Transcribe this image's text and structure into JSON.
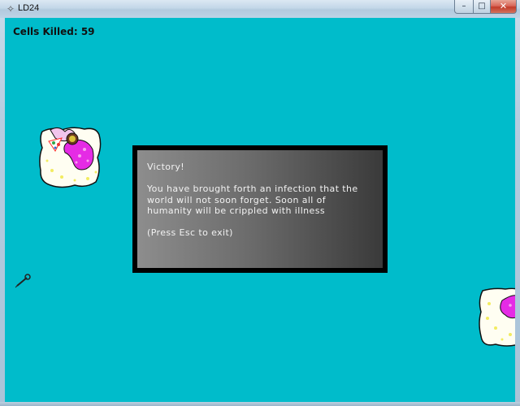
{
  "window": {
    "title": "LD24",
    "buttons": {
      "minimize": "–",
      "maximize": "□",
      "close": "✕"
    }
  },
  "hud": {
    "score_text": "Cells Killed: 59"
  },
  "dialog": {
    "heading": "Victory!",
    "message": "You have brought forth an infection that the world will not soon forget.  Soon all of humanity will be crippled with illness",
    "hint": "(Press Esc to exit)"
  },
  "colors": {
    "canvas_bg": "#00bccb",
    "cell_body": "#fffef2",
    "nucleus": "#e52be5",
    "dialog_border": "#000000"
  }
}
